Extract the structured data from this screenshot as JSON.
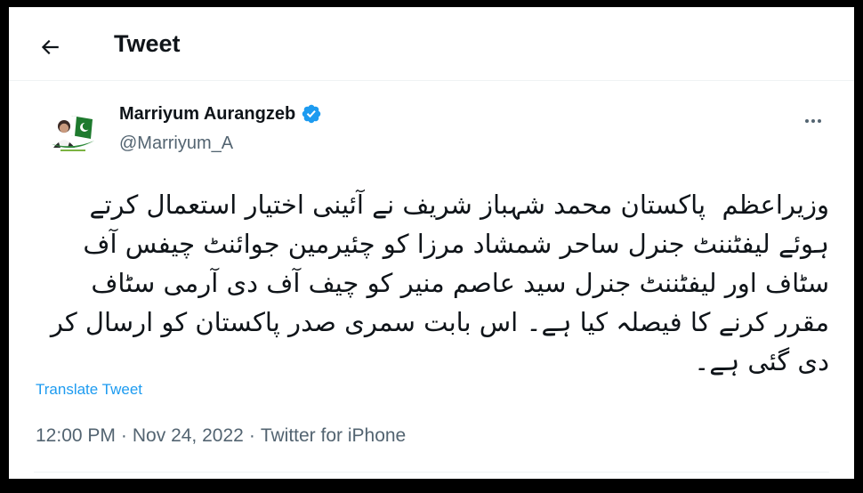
{
  "header": {
    "title": "Tweet",
    "back_icon": "arrow-left-icon"
  },
  "author": {
    "name": "Marriyum Aurangzeb",
    "handle": "@Marriyum_A",
    "verified": true,
    "avatar_icon": "profile-photo",
    "more_icon": "more-horizontal-icon"
  },
  "tweet": {
    "text": "وزیراعظم  پاکستان محمد شہباز شریف نے آئینی اختیار استعمال کرتے ہوئے لیفٹننٹ جنرل ساحر شمشاد مرزا کو چئیرمین جوائنٹ چیفس آف سٹاف اور لیفٹننٹ جنرل سید عاصم منیر کو چیف آف دی آرمی سٹاف مقرر کرنے کا فیصلہ کیا ہے۔ اس بابت سمری صدر پاکستان کو ارسال کر دی گئی ہے۔",
    "translate_label": "Translate Tweet",
    "time": "12:00 PM",
    "date": "Nov 24, 2022",
    "source": "Twitter for iPhone",
    "separator": "·"
  },
  "colors": {
    "text_primary": "#0f1419",
    "text_secondary": "#536471",
    "accent": "#1d9bf0",
    "verified": "#1d9bf0",
    "border": "#eff3f4"
  }
}
